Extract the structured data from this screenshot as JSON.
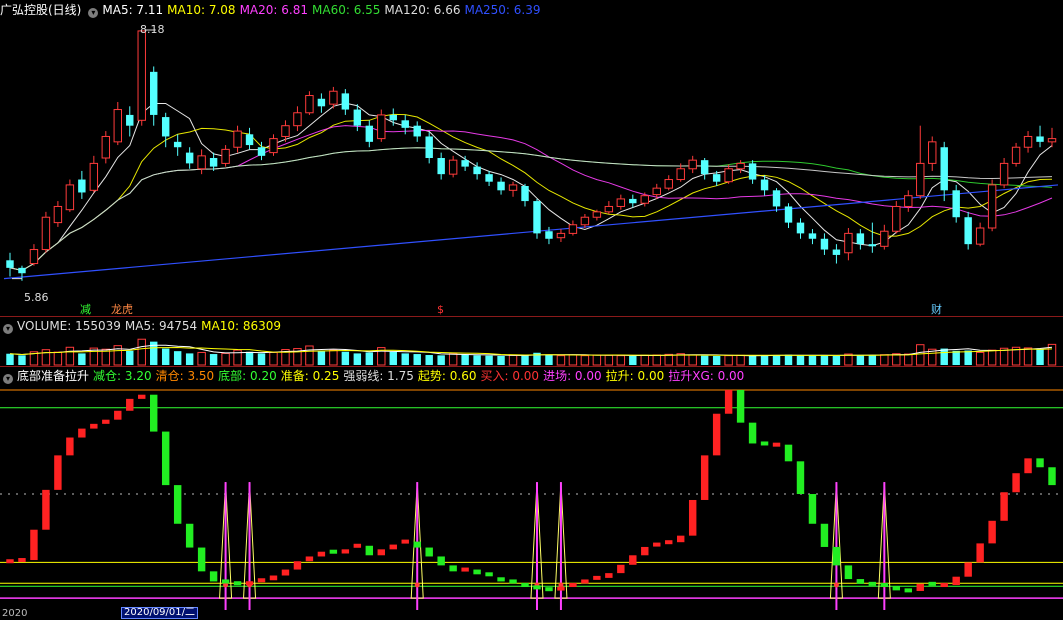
{
  "stock": {
    "name": "广弘控股",
    "period": "(日线)",
    "title": "广弘控股(日线)"
  },
  "price_panel": {
    "ma": [
      {
        "label": "MA5: 7.11",
        "color": "#ffffff"
      },
      {
        "label": "MA10: 7.08",
        "color": "#ffff00"
      },
      {
        "label": "MA20: 6.81",
        "color": "#ff40ff"
      },
      {
        "label": "MA60: 6.55",
        "color": "#33dd33"
      },
      {
        "label": "MA120: 6.66",
        "color": "#dddddd"
      },
      {
        "label": "MA250: 6.39",
        "color": "#3050ff"
      }
    ],
    "high_label": "8.18",
    "low_label": "5.86",
    "annotations": [
      {
        "text": "减",
        "color": "#33ff33"
      },
      {
        "text": "龙虎",
        "color": "#ff8844"
      },
      {
        "text": "$",
        "color": "#ff3333"
      },
      {
        "text": "财",
        "color": "#66ccff"
      }
    ]
  },
  "volume_panel": {
    "items": [
      {
        "label": "VOLUME: 155039",
        "color": "#dddddd"
      },
      {
        "label": "MA5: 94754",
        "color": "#dddddd"
      },
      {
        "label": "MA10: 86309",
        "color": "#ffff00"
      }
    ]
  },
  "indicator_panel": {
    "name": "底部准备拉升",
    "items": [
      {
        "label": "减仓: 3.20",
        "color": "#33ff33"
      },
      {
        "label": "清仓: 3.50",
        "color": "#ff8800"
      },
      {
        "label": "底部: 0.20",
        "color": "#33ff33"
      },
      {
        "label": "准备: 0.25",
        "color": "#ffff00"
      },
      {
        "label": "强弱线: 1.75",
        "color": "#dddddd"
      },
      {
        "label": "起势: 0.60",
        "color": "#ffff00"
      },
      {
        "label": "买入: 0.00",
        "color": "#ff3333"
      },
      {
        "label": "进场: 0.00",
        "color": "#ff40ff"
      },
      {
        "label": "拉升: 0.00",
        "color": "#ffff00"
      },
      {
        "label": "拉升XG: 0.00",
        "color": "#ff40ff"
      }
    ]
  },
  "axis": {
    "date_left": "2020",
    "date_box": "2020/09/01/二"
  },
  "chart_data": {
    "type": "candlestick",
    "count": 88,
    "price_ylim": [
      5.7,
      8.3
    ],
    "candles": [
      [
        6.05,
        5.98,
        6.12,
        5.9
      ],
      [
        5.98,
        5.93,
        6.0,
        5.86
      ],
      [
        6.02,
        6.15,
        6.2,
        6.0
      ],
      [
        6.15,
        6.45,
        6.5,
        6.12
      ],
      [
        6.4,
        6.55,
        6.6,
        6.36
      ],
      [
        6.52,
        6.75,
        6.8,
        6.5
      ],
      [
        6.8,
        6.68,
        6.88,
        6.62
      ],
      [
        6.7,
        6.95,
        7.02,
        6.68
      ],
      [
        7.0,
        7.2,
        7.25,
        6.95
      ],
      [
        7.15,
        7.45,
        7.52,
        7.12
      ],
      [
        7.4,
        7.3,
        7.48,
        7.2
      ],
      [
        7.35,
        8.18,
        8.18,
        7.3
      ],
      [
        7.8,
        7.4,
        7.85,
        7.3
      ],
      [
        7.38,
        7.2,
        7.42,
        7.1
      ],
      [
        7.15,
        7.1,
        7.22,
        7.02
      ],
      [
        7.05,
        6.95,
        7.1,
        6.9
      ],
      [
        6.9,
        7.02,
        7.08,
        6.85
      ],
      [
        7.0,
        6.92,
        7.05,
        6.88
      ],
      [
        6.95,
        7.08,
        7.12,
        6.92
      ],
      [
        7.1,
        7.25,
        7.3,
        7.05
      ],
      [
        7.22,
        7.12,
        7.28,
        7.08
      ],
      [
        7.1,
        7.02,
        7.15,
        6.98
      ],
      [
        7.05,
        7.18,
        7.22,
        7.02
      ],
      [
        7.2,
        7.3,
        7.35,
        7.15
      ],
      [
        7.3,
        7.42,
        7.48,
        7.25
      ],
      [
        7.42,
        7.58,
        7.62,
        7.4
      ],
      [
        7.55,
        7.48,
        7.6,
        7.42
      ],
      [
        7.5,
        7.62,
        7.66,
        7.46
      ],
      [
        7.6,
        7.45,
        7.64,
        7.4
      ],
      [
        7.45,
        7.3,
        7.5,
        7.25
      ],
      [
        7.3,
        7.15,
        7.35,
        7.1
      ],
      [
        7.18,
        7.4,
        7.45,
        7.15
      ],
      [
        7.4,
        7.35,
        7.46,
        7.3
      ],
      [
        7.35,
        7.28,
        7.4,
        7.22
      ],
      [
        7.3,
        7.2,
        7.34,
        7.15
      ],
      [
        7.2,
        7.0,
        7.24,
        6.95
      ],
      [
        7.0,
        6.85,
        7.05,
        6.8
      ],
      [
        6.85,
        6.98,
        7.02,
        6.82
      ],
      [
        6.98,
        6.92,
        7.02,
        6.88
      ],
      [
        6.92,
        6.85,
        6.96,
        6.8
      ],
      [
        6.85,
        6.78,
        6.88,
        6.74
      ],
      [
        6.78,
        6.7,
        6.82,
        6.66
      ],
      [
        6.7,
        6.75,
        6.78,
        6.64
      ],
      [
        6.74,
        6.6,
        6.76,
        6.55
      ],
      [
        6.6,
        6.3,
        6.62,
        6.25
      ],
      [
        6.32,
        6.25,
        6.36,
        6.2
      ],
      [
        6.26,
        6.3,
        6.34,
        6.22
      ],
      [
        6.3,
        6.38,
        6.42,
        6.28
      ],
      [
        6.38,
        6.45,
        6.48,
        6.35
      ],
      [
        6.45,
        6.5,
        6.52,
        6.42
      ],
      [
        6.5,
        6.55,
        6.6,
        6.48
      ],
      [
        6.55,
        6.62,
        6.66,
        6.52
      ],
      [
        6.62,
        6.58,
        6.66,
        6.54
      ],
      [
        6.58,
        6.65,
        6.68,
        6.55
      ],
      [
        6.66,
        6.72,
        6.76,
        6.62
      ],
      [
        6.72,
        6.8,
        6.84,
        6.7
      ],
      [
        6.8,
        6.9,
        6.95,
        6.78
      ],
      [
        6.9,
        6.98,
        7.02,
        6.86
      ],
      [
        6.98,
        6.85,
        7.0,
        6.8
      ],
      [
        6.85,
        6.78,
        6.88,
        6.74
      ],
      [
        6.78,
        6.9,
        6.94,
        6.76
      ],
      [
        6.9,
        6.95,
        6.98,
        6.86
      ],
      [
        6.95,
        6.8,
        6.98,
        6.76
      ],
      [
        6.8,
        6.7,
        6.84,
        6.65
      ],
      [
        6.7,
        6.55,
        6.72,
        6.5
      ],
      [
        6.55,
        6.4,
        6.58,
        6.35
      ],
      [
        6.4,
        6.3,
        6.44,
        6.25
      ],
      [
        6.3,
        6.25,
        6.34,
        6.2
      ],
      [
        6.25,
        6.15,
        6.3,
        6.1
      ],
      [
        6.15,
        6.1,
        6.2,
        6.02
      ],
      [
        6.12,
        6.3,
        6.35,
        6.05
      ],
      [
        6.3,
        6.2,
        6.34,
        6.15
      ],
      [
        6.2,
        6.18,
        6.4,
        6.12
      ],
      [
        6.18,
        6.32,
        6.38,
        6.15
      ],
      [
        6.32,
        6.55,
        6.6,
        6.3
      ],
      [
        6.55,
        6.65,
        6.7,
        6.5
      ],
      [
        6.65,
        6.95,
        7.3,
        6.62
      ],
      [
        6.95,
        7.15,
        7.2,
        6.88
      ],
      [
        7.1,
        6.7,
        7.15,
        6.6
      ],
      [
        6.7,
        6.45,
        6.75,
        6.4
      ],
      [
        6.45,
        6.2,
        6.5,
        6.15
      ],
      [
        6.2,
        6.35,
        6.4,
        6.18
      ],
      [
        6.35,
        6.75,
        6.8,
        6.32
      ],
      [
        6.75,
        6.95,
        7.0,
        6.72
      ],
      [
        6.95,
        7.1,
        7.14,
        6.92
      ],
      [
        7.1,
        7.2,
        7.25,
        7.05
      ],
      [
        7.2,
        7.15,
        7.3,
        7.1
      ],
      [
        7.15,
        7.18,
        7.28,
        7.1
      ]
    ],
    "volumes": [
      70,
      60,
      82,
      95,
      80,
      110,
      72,
      105,
      98,
      120,
      88,
      160,
      145,
      102,
      86,
      72,
      78,
      68,
      72,
      92,
      82,
      72,
      78,
      96,
      102,
      118,
      86,
      92,
      82,
      72,
      78,
      108,
      82,
      72,
      68,
      62,
      60,
      70,
      65,
      60,
      58,
      56,
      60,
      62,
      76,
      65,
      58,
      62,
      58,
      62,
      60,
      58,
      56,
      60,
      62,
      66,
      70,
      62,
      58,
      56,
      58,
      60,
      58,
      60,
      62,
      64,
      60,
      58,
      60,
      56,
      68,
      60,
      62,
      64,
      70,
      68,
      126,
      98,
      102,
      88,
      90,
      78,
      92,
      104,
      110,
      106,
      100,
      128
    ],
    "vol_ylim": [
      0,
      180
    ],
    "indicator": [
      0.62,
      0.64,
      1.15,
      1.82,
      2.4,
      2.7,
      2.85,
      2.93,
      3.0,
      3.15,
      3.35,
      3.42,
      2.8,
      1.9,
      1.25,
      0.85,
      0.45,
      0.28,
      0.25,
      0.22,
      0.25,
      0.3,
      0.38,
      0.48,
      0.62,
      0.7,
      0.78,
      0.75,
      0.82,
      0.88,
      0.72,
      0.82,
      0.9,
      0.95,
      0.85,
      0.7,
      0.55,
      0.45,
      0.48,
      0.4,
      0.35,
      0.28,
      0.22,
      0.18,
      0.15,
      0.12,
      0.16,
      0.22,
      0.28,
      0.34,
      0.42,
      0.56,
      0.72,
      0.86,
      0.9,
      0.94,
      1.05,
      1.65,
      2.4,
      3.1,
      3.5,
      2.95,
      2.6,
      2.56,
      2.58,
      2.3,
      1.75,
      1.25,
      0.86,
      0.55,
      0.32,
      0.24,
      0.22,
      0.2,
      0.13,
      0.12,
      0.24,
      0.2,
      0.22,
      0.36,
      0.6,
      0.92,
      1.3,
      1.78,
      2.1,
      2.35,
      2.2,
      1.9
    ],
    "ind_ylim": [
      -0.2,
      3.6
    ],
    "lines": {
      "qingcang": 3.5,
      "jiancang": 3.2,
      "qishi": 0.6,
      "zhunbei": 0.25,
      "dibu": 0.2
    },
    "spikes": [
      18,
      20,
      34,
      44,
      46,
      69,
      73
    ]
  }
}
